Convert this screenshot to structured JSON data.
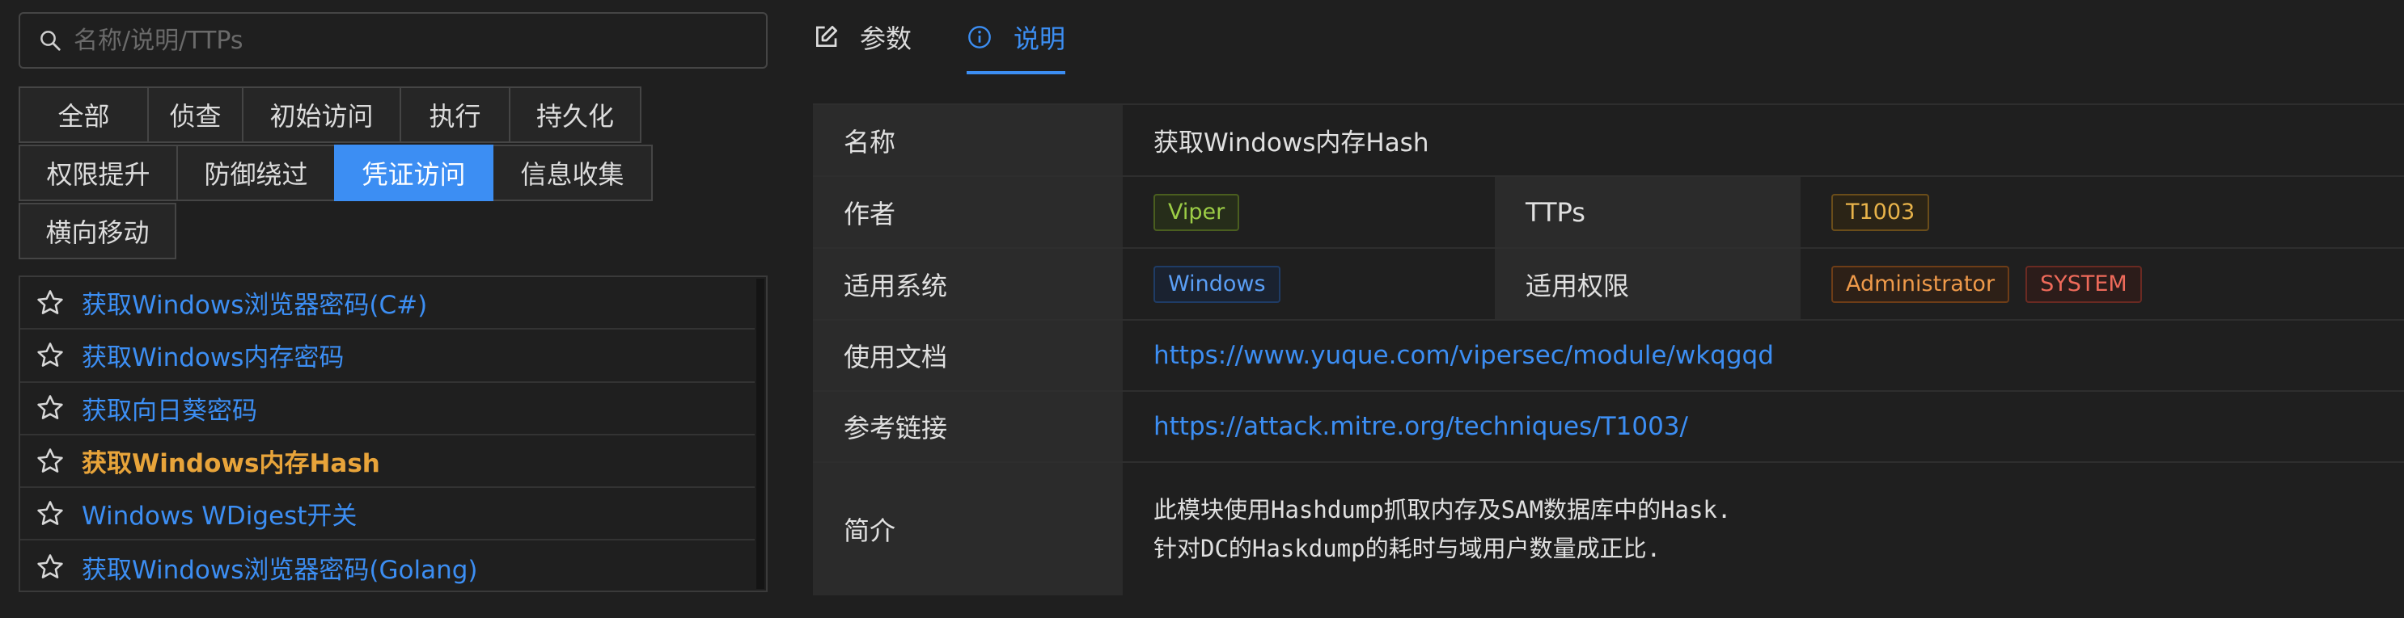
{
  "search": {
    "placeholder": "名称/说明/TTPs",
    "icon": "search-icon"
  },
  "categories": {
    "row1": [
      "全部",
      "侦查",
      "初始访问",
      "执行",
      "持久化"
    ],
    "row2": [
      "权限提升",
      "防御绕过",
      "凭证访问",
      "信息收集"
    ],
    "row3": [
      "横向移动"
    ],
    "active": "凭证访问"
  },
  "modules": [
    {
      "label": "获取Windows浏览器密码(C#)"
    },
    {
      "label": "获取Windows内存密码"
    },
    {
      "label": "获取向日葵密码"
    },
    {
      "label": "获取Windows内存Hash",
      "selected": true
    },
    {
      "label": "Windows WDigest开关"
    },
    {
      "label": "获取Windows浏览器密码(Golang)"
    }
  ],
  "tabs": {
    "params": "参数",
    "description": "说明",
    "active": "说明"
  },
  "details": {
    "name_label": "名称",
    "name_value": "获取Windows内存Hash",
    "author_label": "作者",
    "author_value": "Viper",
    "ttps_label": "TTPs",
    "ttps_value": "T1003",
    "os_label": "适用系统",
    "os_value": "Windows",
    "perm_label": "适用权限",
    "perm_values": [
      "Administrator",
      "SYSTEM"
    ],
    "doc_label": "使用文档",
    "doc_value": "https://www.yuque.com/vipersec/module/wkqgqd",
    "ref_label": "参考链接",
    "ref_value": "https://attack.mitre.org/techniques/T1003/",
    "summary_label": "简介",
    "summary_lines": [
      "此模块使用Hashdump抓取内存及SAM数据库中的Hask.",
      "针对DC的Haskdump的耗时与域用户数量成正比."
    ]
  },
  "colors": {
    "accent": "#3c8ef3",
    "selected_item": "#e8a43a",
    "background": "#1f1f1f"
  }
}
